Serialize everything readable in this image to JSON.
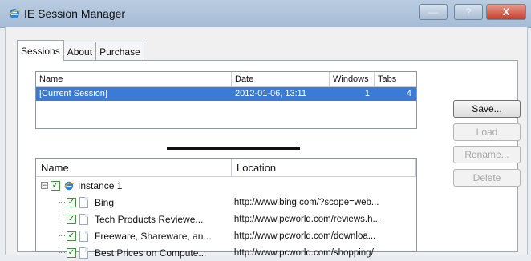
{
  "window": {
    "title": "IE Session Manager",
    "minimize": "—",
    "maximize": "?",
    "close": "X"
  },
  "tabs": [
    {
      "label": "Sessions",
      "active": true
    },
    {
      "label": "About",
      "active": false
    },
    {
      "label": "Purchase",
      "active": false
    }
  ],
  "sessions_table": {
    "headers": {
      "name": "Name",
      "date": "Date",
      "windows": "Windows",
      "tabs": "Tabs"
    },
    "rows": [
      {
        "name": "[Current Session]",
        "date": "2012-01-06, 13:11",
        "windows": "1",
        "tabs": "4",
        "selected": true
      }
    ]
  },
  "tree": {
    "headers": {
      "name": "Name",
      "location": "Location"
    },
    "instance": {
      "label": "Instance 1",
      "expander": "⊟",
      "checked": "✓"
    },
    "items": [
      {
        "name": "Bing",
        "location": "http://www.bing.com/?scope=web..."
      },
      {
        "name": "Tech Products Reviewe...",
        "location": "http://www.pcworld.com/reviews.h..."
      },
      {
        "name": "Freeware, Shareware, an...",
        "location": "http://www.pcworld.com/downloa..."
      },
      {
        "name": "Best Prices on Compute...",
        "location": "http://www.pcworld.com/shopping/"
      }
    ],
    "check_glyph": "✓"
  },
  "buttons": {
    "save": "Save...",
    "load": "Load",
    "rename": "Rename...",
    "delete": "Delete"
  },
  "colors": {
    "selection": "#3a7bd5",
    "close_button": "#c6402b"
  }
}
